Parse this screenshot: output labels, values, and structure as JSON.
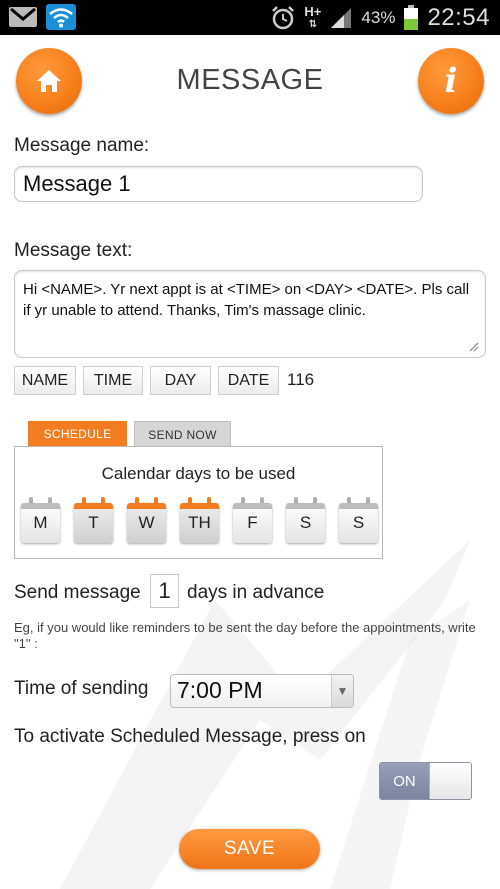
{
  "status_bar": {
    "signal_label": "H+",
    "battery": "43%",
    "time": "22:54",
    "icons": [
      "gmail-icon",
      "wifi-icon",
      "alarm-icon",
      "signal-icon",
      "battery-icon"
    ]
  },
  "header": {
    "title": "MESSAGE",
    "home_icon": "home-icon",
    "info_icon": "info-icon",
    "info_glyph": "i"
  },
  "form": {
    "name_label": "Message name:",
    "name_value": "Message 1",
    "text_label": "Message text:",
    "text_value": "Hi <NAME>. Yr next appt is at <TIME> on <DAY> <DATE>. Pls call if yr unable to attend. Thanks, Tim's massage clinic.",
    "tokens": [
      "NAME",
      "TIME",
      "DAY",
      "DATE"
    ],
    "char_count": "116"
  },
  "tabs": {
    "schedule": "SCHEDULE",
    "send_now": "SEND NOW",
    "active": "schedule"
  },
  "schedule": {
    "panel_title": "Calendar days to be used",
    "days": [
      {
        "label": "M",
        "selected": false
      },
      {
        "label": "T",
        "selected": true
      },
      {
        "label": "W",
        "selected": true
      },
      {
        "label": "TH",
        "selected": true
      },
      {
        "label": "F",
        "selected": false
      },
      {
        "label": "S",
        "selected": false
      },
      {
        "label": "S",
        "selected": false
      }
    ],
    "advance_prefix": "Send message",
    "advance_value": "1",
    "advance_suffix": "days in advance",
    "hint": "Eg, if you would like reminders to be sent the day before the appointments, write \"1\" :",
    "time_label": "Time of sending",
    "time_value": "7:00 PM",
    "activate_label": "To activate Scheduled Message, press on",
    "toggle_label": "ON",
    "toggle_state": true
  },
  "actions": {
    "save_label": "SAVE"
  },
  "colors": {
    "accent": "#f47c20",
    "status_bar": "#000000",
    "toggle_on": "#8a92ab"
  }
}
